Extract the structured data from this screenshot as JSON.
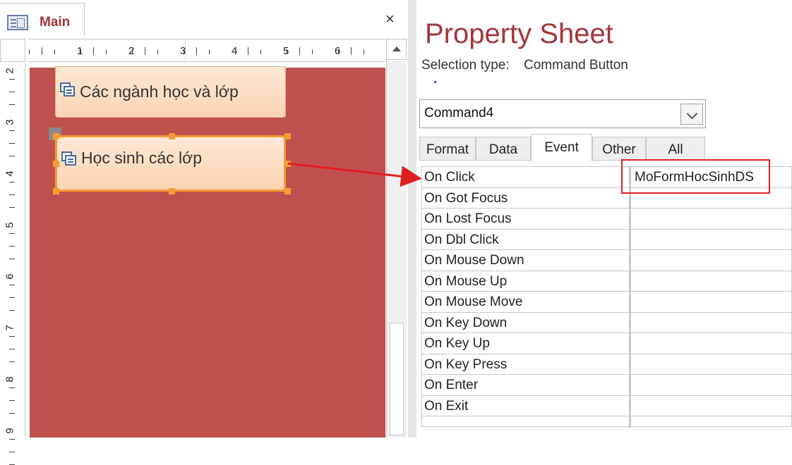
{
  "designer": {
    "tab_label": "Main",
    "close_glyph": "×",
    "ruler_numbers": [
      "1",
      "2",
      "3",
      "4",
      "5",
      "6"
    ],
    "vruler_numbers": [
      "2",
      "3",
      "4",
      "5",
      "6",
      "7",
      "8",
      "9"
    ],
    "buttons": [
      {
        "label": "Các ngành học và lớp"
      },
      {
        "label": "Học sinh các lớp"
      }
    ]
  },
  "property_sheet": {
    "title": "Property Sheet",
    "selection_type_label": "Selection type:",
    "selection_type_value": "Command Button",
    "object_combo_value": "Command4",
    "tabs": [
      "Format",
      "Data",
      "Event",
      "Other",
      "All"
    ],
    "active_tab": "Event",
    "properties": [
      {
        "name": "On Click",
        "value": "MoFormHocSinhDS"
      },
      {
        "name": "On Got Focus",
        "value": ""
      },
      {
        "name": "On Lost Focus",
        "value": ""
      },
      {
        "name": "On Dbl Click",
        "value": ""
      },
      {
        "name": "On Mouse Down",
        "value": ""
      },
      {
        "name": "On Mouse Up",
        "value": ""
      },
      {
        "name": "On Mouse Move",
        "value": ""
      },
      {
        "name": "On Key Down",
        "value": ""
      },
      {
        "name": "On Key Up",
        "value": ""
      },
      {
        "name": "On Key Press",
        "value": ""
      },
      {
        "name": "On Enter",
        "value": ""
      },
      {
        "name": "On Exit",
        "value": ""
      }
    ]
  },
  "colors": {
    "accent": "#a4373a",
    "canvas": "#c0504d",
    "selection": "#f39c34",
    "annotation": "#e02020"
  }
}
